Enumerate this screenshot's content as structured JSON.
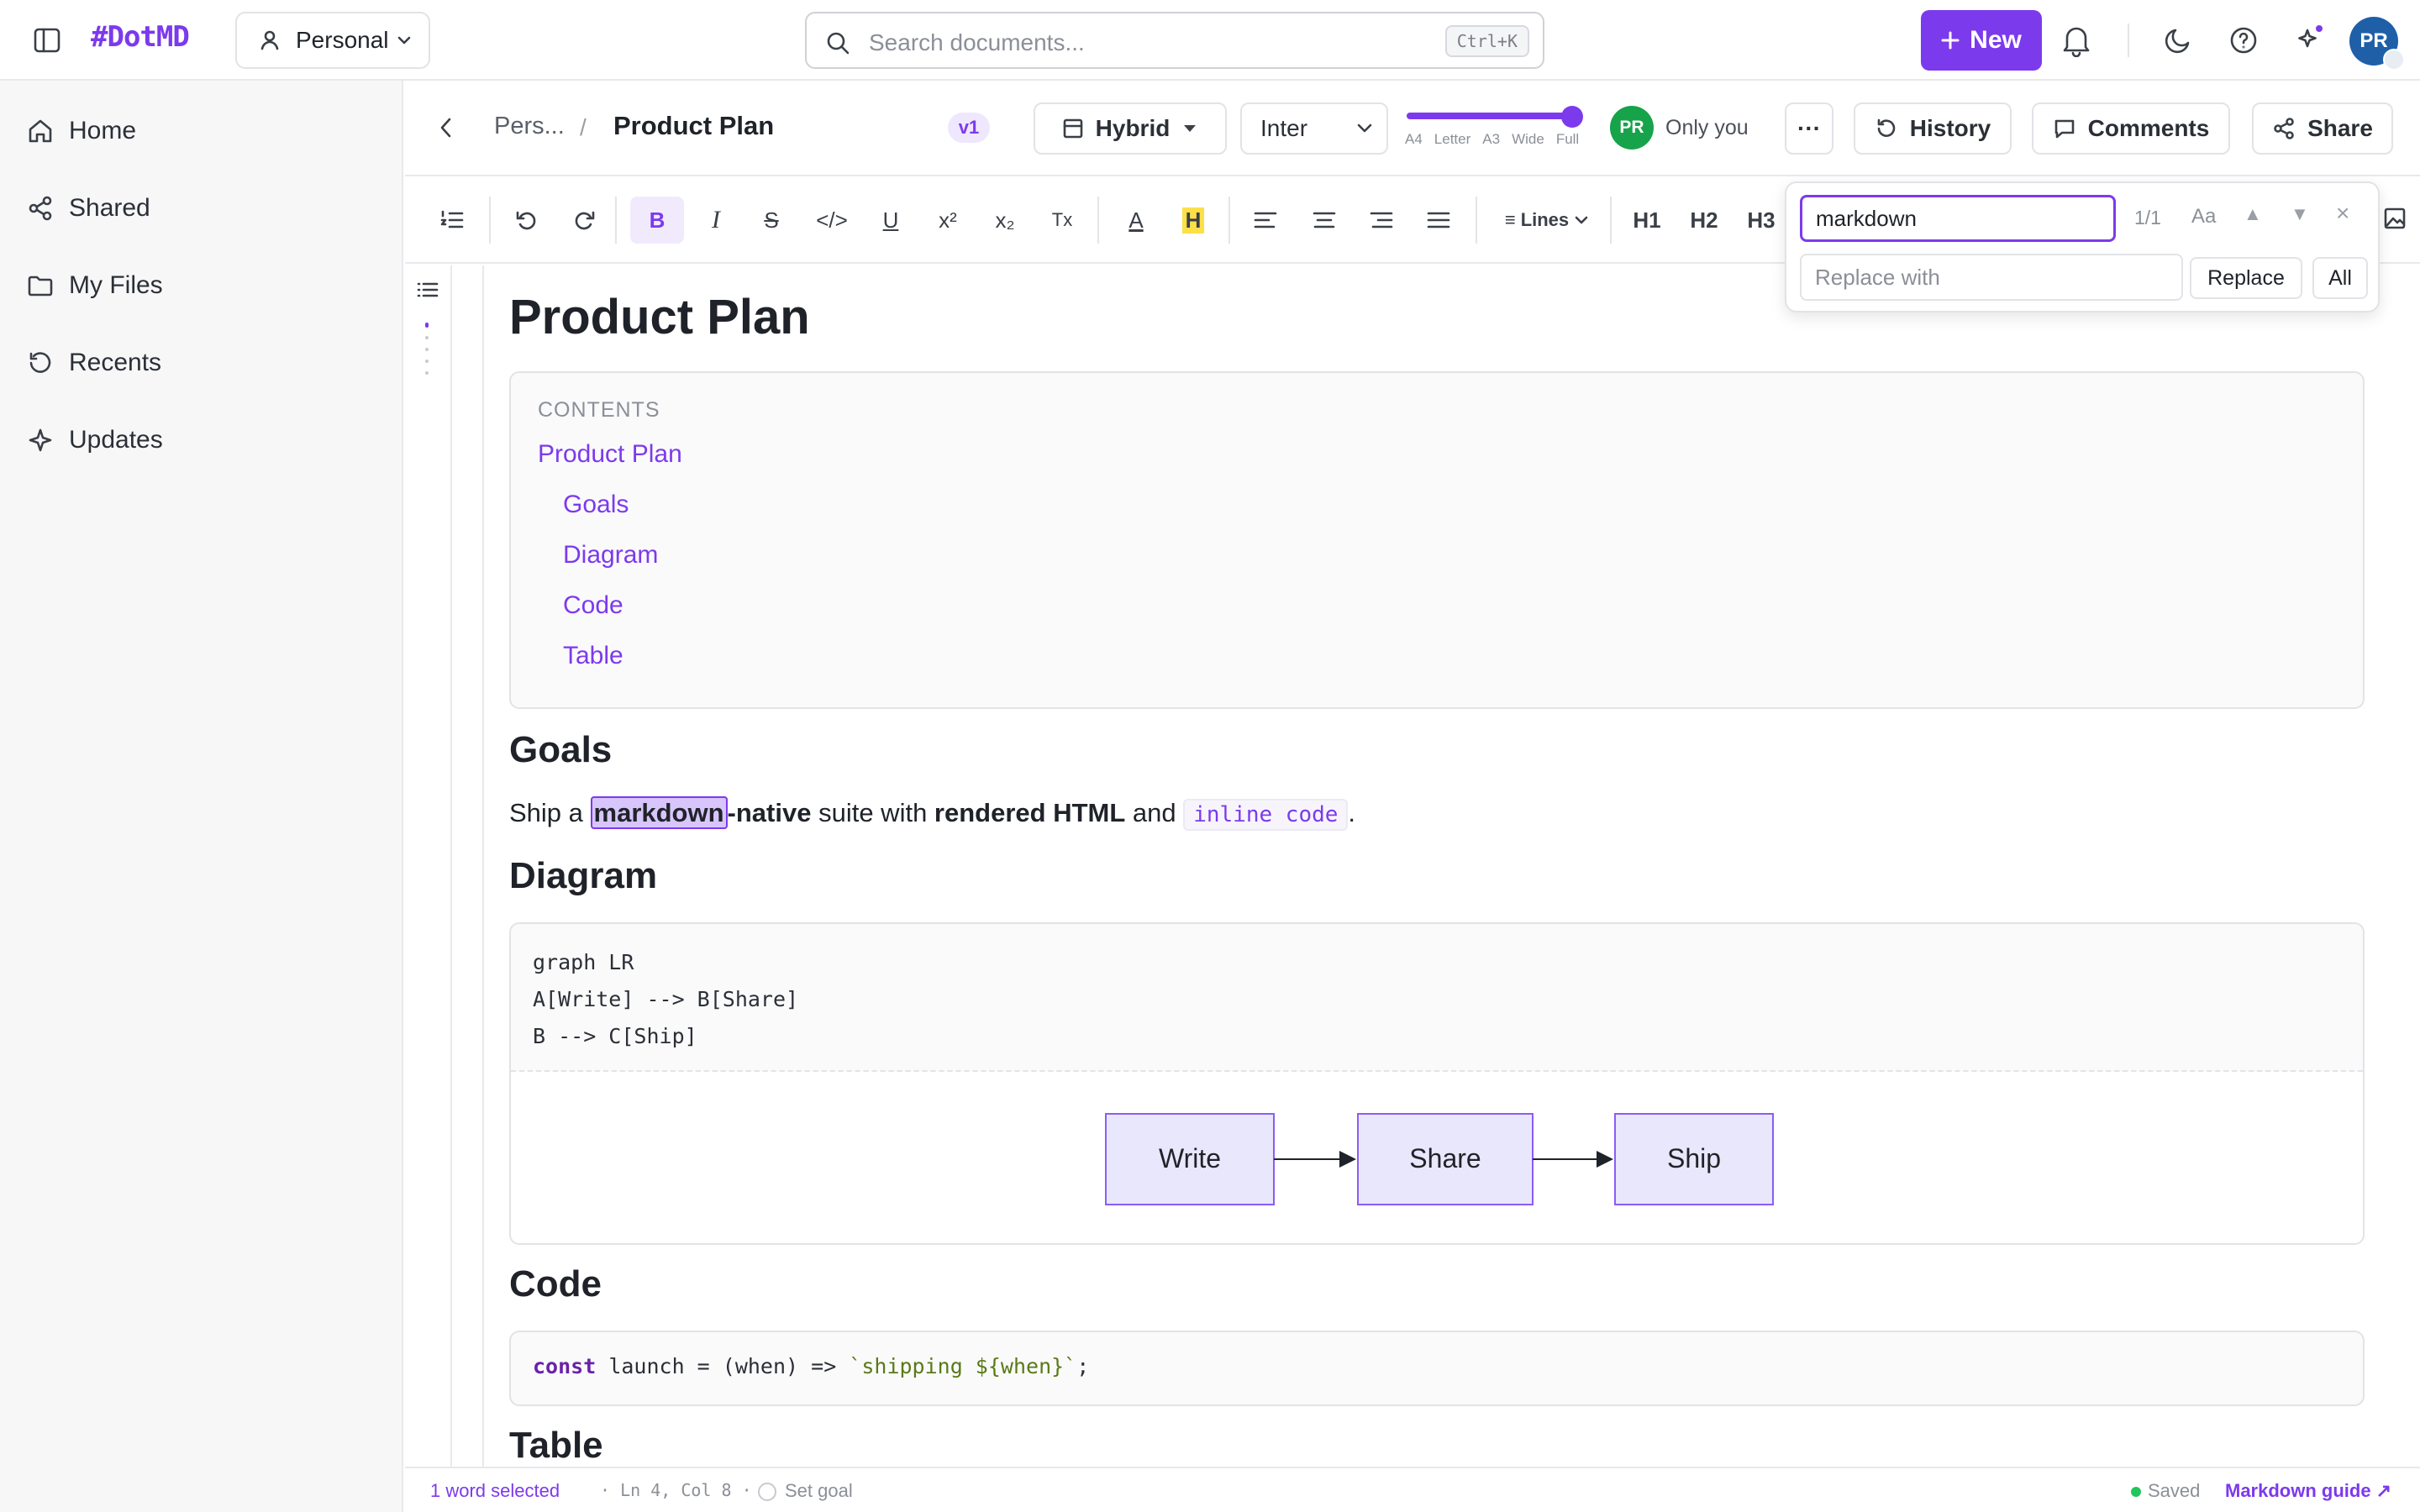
{
  "app": {
    "logo": "#DotMD",
    "workspace": "Personal"
  },
  "search": {
    "placeholder": "Search documents...",
    "shortcut": "Ctrl+K"
  },
  "top_actions": {
    "new_label": "New",
    "avatar_initials": "PR"
  },
  "sidebar": {
    "items": [
      {
        "label": "Home",
        "icon": "home-icon"
      },
      {
        "label": "Shared",
        "icon": "share-icon"
      },
      {
        "label": "My Files",
        "icon": "folder-icon"
      },
      {
        "label": "Recents",
        "icon": "history-icon"
      },
      {
        "label": "Updates",
        "icon": "sparkle-icon"
      }
    ]
  },
  "doc_header": {
    "breadcrumb": "Pers...",
    "separator": "/",
    "title": "Product Plan",
    "version": "v1",
    "view_mode": "Hybrid",
    "font": "Inter",
    "page_widths": [
      "A4",
      "Letter",
      "A3",
      "Wide",
      "Full"
    ],
    "page_width_selected": "Full",
    "share_initials": "PR",
    "visibility": "Only you",
    "more_label": "···",
    "history_label": "History",
    "comments_label": "Comments",
    "share_label": "Share"
  },
  "toolbar": {
    "bold": "B",
    "italic": "I",
    "strike": "S",
    "code": "</>",
    "underline": "U",
    "superscript": "x²",
    "subscript": "x₂",
    "clear": "Tx",
    "text_color": "A",
    "highlight": "H",
    "lines": "Lines",
    "h1": "H1",
    "h2": "H2",
    "h3": "H3"
  },
  "find_replace": {
    "find_value": "markdown",
    "count": "1/1",
    "case_label": "Aa",
    "prev": "▲",
    "next": "▼",
    "close": "×",
    "replace_placeholder": "Replace with",
    "replace_label": "Replace",
    "replace_all_label": "All"
  },
  "document": {
    "title": "Product Plan",
    "toc": {
      "label": "CONTENTS",
      "items": [
        "Product Plan",
        "Goals",
        "Diagram",
        "Code",
        "Table"
      ]
    },
    "goals": {
      "heading": "Goals",
      "p1": "Ship a ",
      "p_highlight": "markdown",
      "p2": "-native",
      "p3": " suite with ",
      "p4": "rendered HTML",
      "p5": " and ",
      "p_code": "inline code",
      "p6": "."
    },
    "diagram": {
      "heading": "Diagram",
      "source": "graph LR\nA[Write] --> B[Share]\nB --> C[Ship]",
      "nodes": [
        "Write",
        "Share",
        "Ship"
      ]
    },
    "code": {
      "heading": "Code",
      "kw": "const",
      "mid": " launch = (when) => ",
      "str": "`shipping ${when}`",
      "end": ";"
    },
    "table": {
      "heading": "Table"
    }
  },
  "status": {
    "selection": "1 word selected",
    "position": "· Ln 4, Col 8 ·",
    "goal": "Set goal",
    "saved": "Saved",
    "guide": "Markdown guide ↗"
  },
  "colors": {
    "accent": "#7c3aed",
    "diagram_fill": "#e9e7fb",
    "diagram_stroke": "#8b5cf6"
  }
}
